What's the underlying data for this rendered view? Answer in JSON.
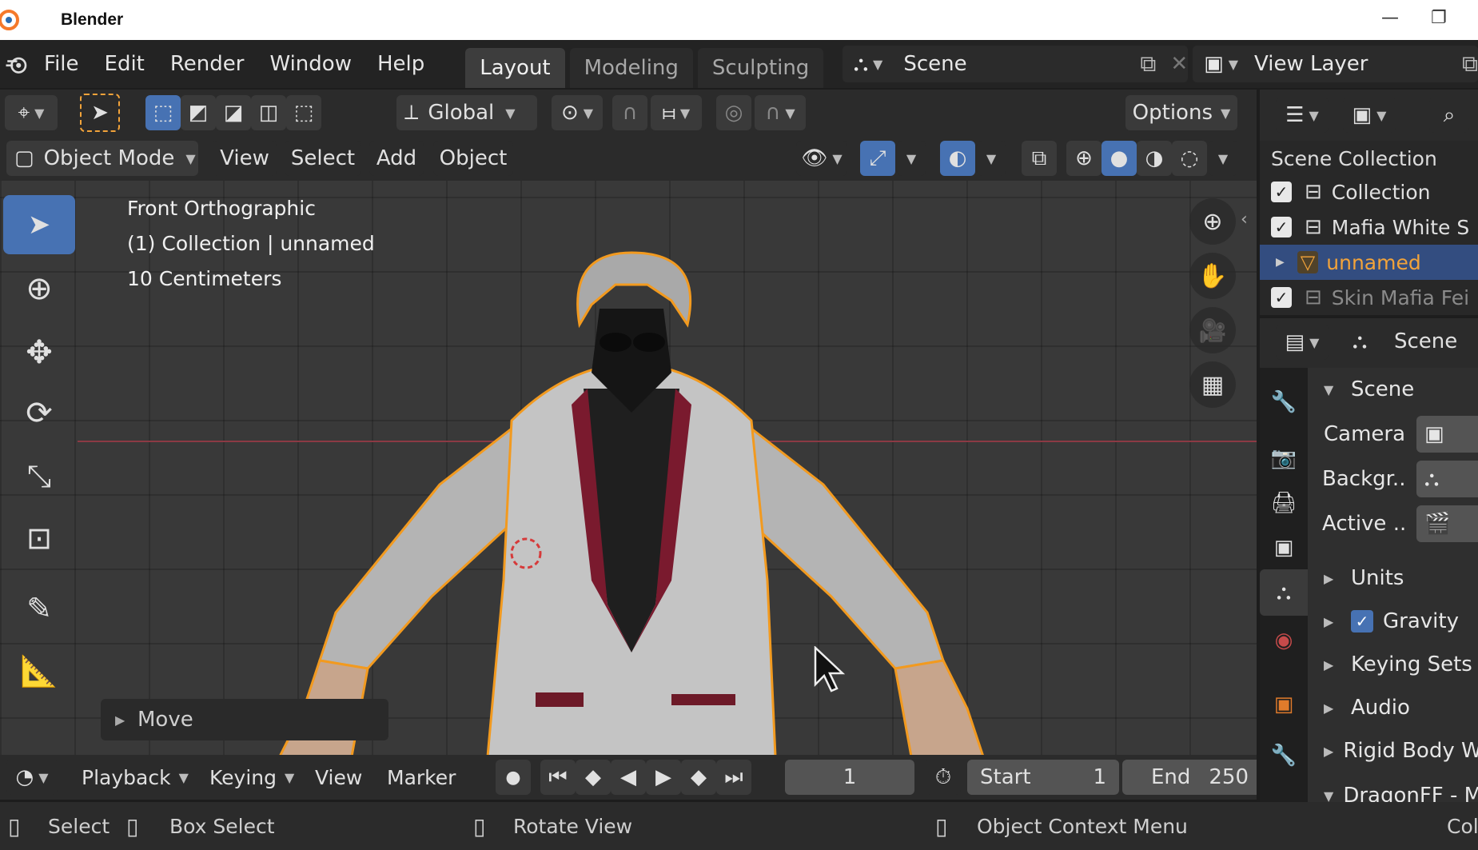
{
  "window": {
    "title": "Blender"
  },
  "menubar": {
    "items": [
      "File",
      "Edit",
      "Render",
      "Window",
      "Help"
    ],
    "workspaces": [
      "Layout",
      "Modeling",
      "Sculpting"
    ],
    "active_workspace": "Layout",
    "scene": "Scene",
    "view_layer": "View Layer"
  },
  "toolbar": {
    "orientation": "Global",
    "options": "Options"
  },
  "viewport_header": {
    "mode": "Object Mode",
    "menus": [
      "View",
      "Select",
      "Add",
      "Object"
    ]
  },
  "viewport": {
    "view_name": "Front Orthographic",
    "collection_info": "(1) Collection | unnamed",
    "scale": "10 Centimeters",
    "last_op": "Move"
  },
  "outliner": {
    "title": "Scene Collection",
    "items": [
      {
        "label": "Collection",
        "checked": true
      },
      {
        "label": "Mafia White S",
        "checked": true
      },
      {
        "label": "unnamed",
        "selected": true
      },
      {
        "label": "Skin Mafia Fei",
        "checked": true,
        "dim": true
      }
    ]
  },
  "properties": {
    "context": "Scene",
    "panel_title": "Scene",
    "fields": [
      "Camera",
      "Backgr..",
      "Active .."
    ],
    "sections": [
      "Units",
      "Gravity",
      "Keying Sets",
      "Audio",
      "Rigid Body W",
      "DragonFF - M"
    ]
  },
  "timeline": {
    "menus": [
      "Playback",
      "Keying",
      "View",
      "Marker"
    ],
    "current_frame": "1",
    "start_label": "Start",
    "start_value": "1",
    "end_label": "End",
    "end_value": "250"
  },
  "statusbar": {
    "items": [
      "Select",
      "Box Select",
      "Rotate View",
      "Object Context Menu",
      "Col"
    ]
  },
  "colors": {
    "accent": "#4772b3",
    "selection_outline": "#f29a1f",
    "x_axis": "#8b3a44"
  }
}
